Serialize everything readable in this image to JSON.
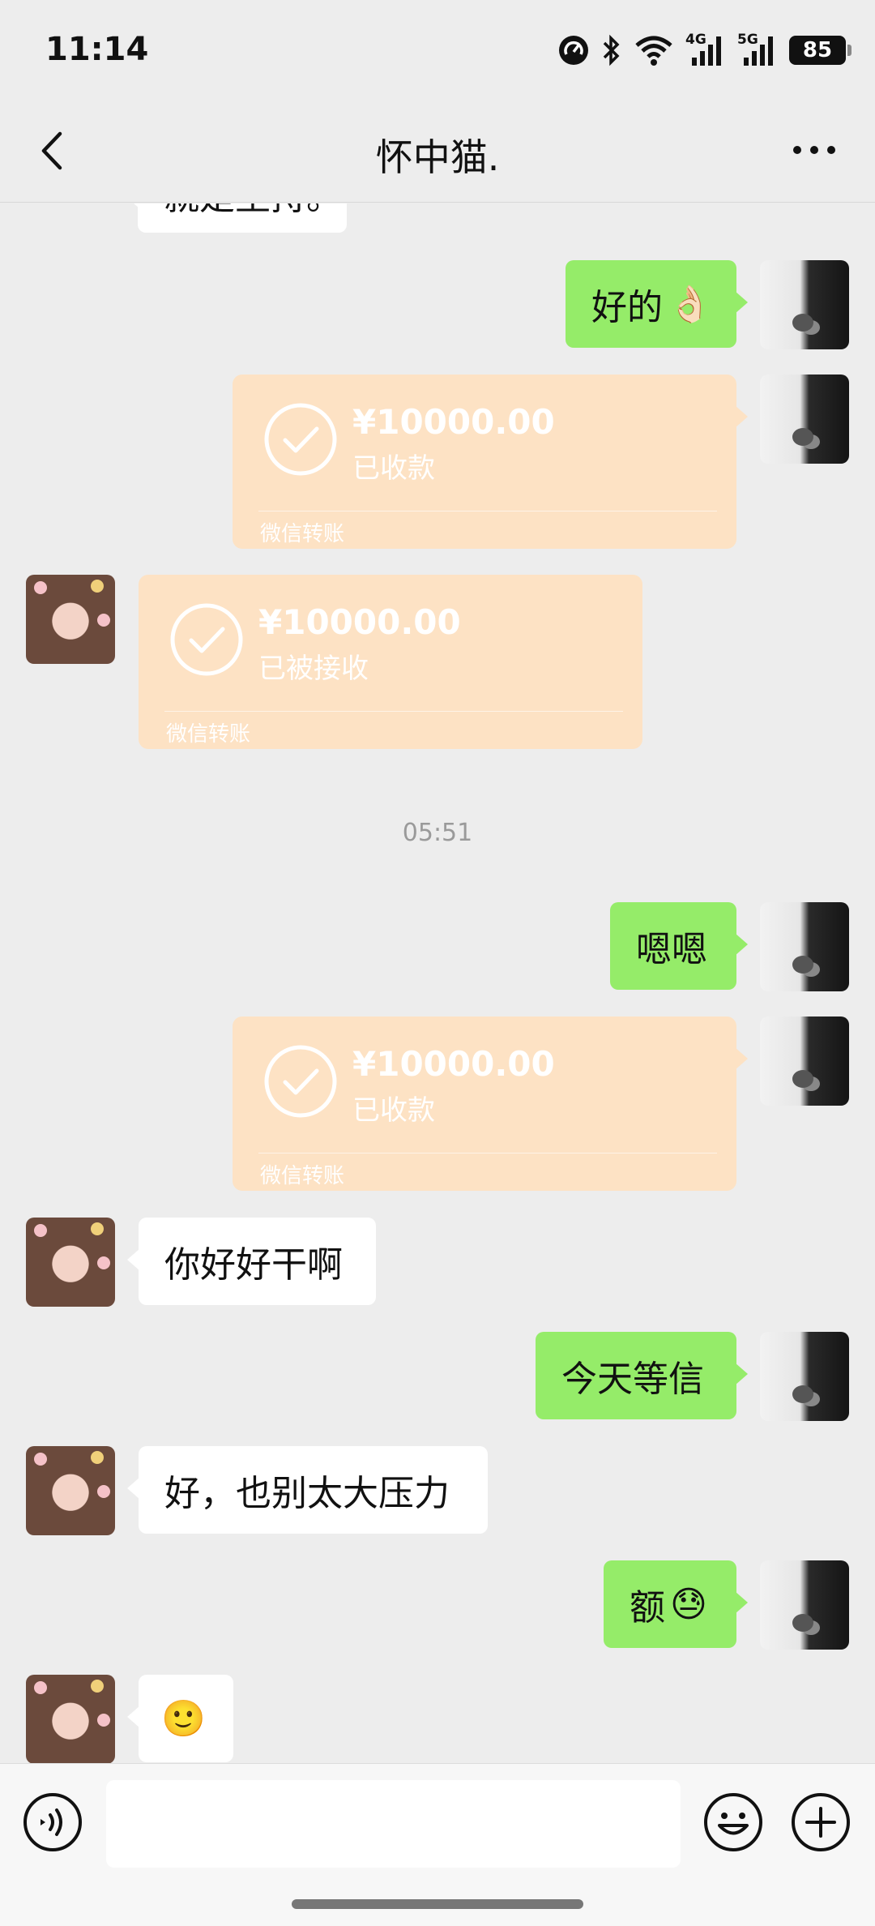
{
  "status_bar": {
    "time": "11:14",
    "network_4g": "4G",
    "network_5g": "5G",
    "battery": "85"
  },
  "header": {
    "title": "怀中猫."
  },
  "messages": [
    {
      "side": "other",
      "type": "text",
      "text": "就是坚持。"
    },
    {
      "side": "me",
      "type": "text",
      "text": "好的",
      "emoji": "👌🏻"
    },
    {
      "side": "me",
      "type": "transfer",
      "amount": "¥10000.00",
      "status": "已收款",
      "footer": "微信转账"
    },
    {
      "side": "other",
      "type": "transfer",
      "amount": "¥10000.00",
      "status": "已被接收",
      "footer": "微信转账"
    },
    {
      "type": "time",
      "text": "05:51"
    },
    {
      "side": "me",
      "type": "text",
      "text": "嗯嗯"
    },
    {
      "side": "me",
      "type": "transfer",
      "amount": "¥10000.00",
      "status": "已收款",
      "footer": "微信转账"
    },
    {
      "side": "other",
      "type": "text",
      "text": "你好好干啊"
    },
    {
      "side": "me",
      "type": "text",
      "text": "今天等信"
    },
    {
      "side": "other",
      "type": "text",
      "text": "好，也别太大压力"
    },
    {
      "side": "me",
      "type": "text",
      "text": "额",
      "emoji": "😓"
    },
    {
      "side": "other",
      "type": "text",
      "text": "",
      "emoji": "🙂"
    }
  ],
  "input": {
    "placeholder": ""
  },
  "colors": {
    "background": "#ededed",
    "my_bubble": "#95ec69",
    "other_bubble": "#ffffff",
    "transfer_bubble": "#fde2c4"
  },
  "icons": [
    "back-chevron-icon",
    "more-dots-icon",
    "voice-icon",
    "emoji-icon",
    "plus-icon",
    "check-circle-icon"
  ]
}
